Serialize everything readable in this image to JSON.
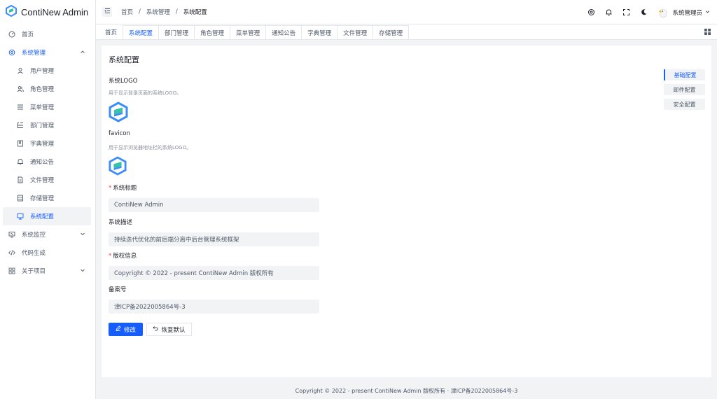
{
  "app": {
    "title": "ContiNew Admin"
  },
  "colors": {
    "primary": "#165dff",
    "required": "#f53f3f"
  },
  "sidebar": {
    "items": [
      {
        "label": "首页",
        "icon": "dashboard-icon"
      },
      {
        "label": "系统管理",
        "icon": "settings-icon"
      },
      {
        "label": "用户管理",
        "icon": "user-icon"
      },
      {
        "label": "角色管理",
        "icon": "user-group-icon"
      },
      {
        "label": "菜单管理",
        "icon": "menu-list-icon"
      },
      {
        "label": "部门管理",
        "icon": "mind-mapping-icon"
      },
      {
        "label": "字典管理",
        "icon": "bookmark-icon"
      },
      {
        "label": "通知公告",
        "icon": "bell-icon"
      },
      {
        "label": "文件管理",
        "icon": "file-icon"
      },
      {
        "label": "存储管理",
        "icon": "storage-icon"
      },
      {
        "label": "系统配置",
        "icon": "desktop-icon"
      },
      {
        "label": "系统监控",
        "icon": "monitor-icon"
      },
      {
        "label": "代码生成",
        "icon": "code-icon"
      },
      {
        "label": "关于项目",
        "icon": "apps-icon"
      }
    ]
  },
  "header": {
    "breadcrumb": [
      "首页",
      "系统管理",
      "系统配置"
    ],
    "separator": "/",
    "user_name": "系统管理员"
  },
  "tabs": [
    "首页",
    "系统配置",
    "部门管理",
    "角色管理",
    "菜单管理",
    "通知公告",
    "字典管理",
    "文件管理",
    "存储管理"
  ],
  "page": {
    "title": "系统配置",
    "logo_label": "系统LOGO",
    "logo_desc": "用于显示登录页面的系统LOGO。",
    "favicon_label": "favicon",
    "favicon_desc": "用于显示浏览器地址栏的系统LOGO。",
    "required_mark": "*",
    "site_title_label": "系统标题",
    "site_title_value": "ContiNew Admin",
    "site_desc_label": "系统描述",
    "site_desc_value": "持续迭代优化的前后端分离中后台管理系统框架",
    "copyright_label": "版权信息",
    "copyright_value": "Copyright © 2022 - present ContiNew Admin 版权所有",
    "beian_label": "备案号",
    "beian_value": "津ICP备2022005864号-3",
    "edit_button": "修改",
    "reset_button": "恢复默认"
  },
  "anchor": [
    "基础配置",
    "邮件配置",
    "安全配置"
  ],
  "footer": "Copyright © 2022 - present ContiNew Admin 版权所有 · 津ICP备2022005864号-3"
}
